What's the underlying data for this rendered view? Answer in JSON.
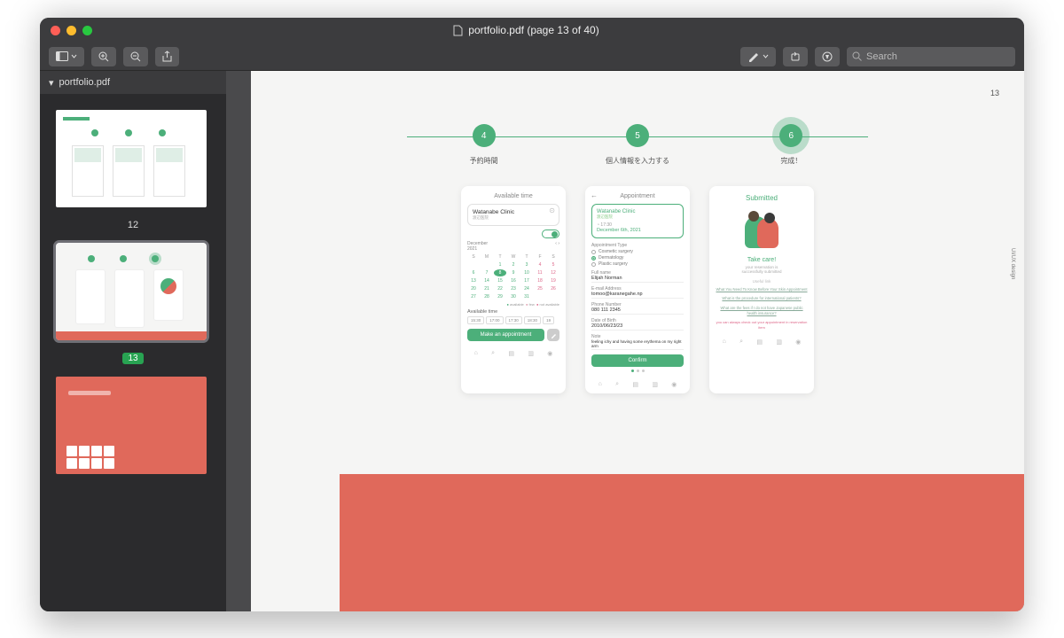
{
  "window": {
    "title": "portfolio.pdf (page 13 of 40)",
    "tab_label": "portfolio.pdf",
    "search_placeholder": "Search",
    "page_number_display": "13"
  },
  "thumbs": {
    "p12_label": "12",
    "p13_label": "13"
  },
  "stepper": {
    "s4": {
      "num": "4",
      "label": "予約時間"
    },
    "s5": {
      "num": "5",
      "label": "個人情報を入力する"
    },
    "s6": {
      "num": "6",
      "label": "完成！"
    }
  },
  "side_text": "UI/UX design",
  "card1": {
    "title": "Available time",
    "clinic_name": "Watanabe Clinic",
    "clinic_sub": "渡辺医院",
    "month": "December",
    "year": "2021",
    "dow": [
      "S",
      "M",
      "T",
      "W",
      "T",
      "F",
      "S"
    ],
    "weeks": [
      [
        "",
        "",
        "1",
        "2",
        "3",
        "4",
        "5"
      ],
      [
        "6",
        "7",
        "8",
        "9",
        "10",
        "11",
        "12"
      ],
      [
        "13",
        "14",
        "15",
        "16",
        "17",
        "18",
        "19"
      ],
      [
        "20",
        "21",
        "22",
        "23",
        "24",
        "25",
        "26"
      ],
      [
        "27",
        "28",
        "29",
        "30",
        "31",
        "",
        ""
      ]
    ],
    "selected_day": "8",
    "legend_available": "available",
    "legend_few": "few",
    "legend_na": "not available",
    "avail_label": "Available time",
    "slots": [
      "15:30",
      "17:00",
      "17:30",
      "18:30",
      "19"
    ],
    "button": "Make an appointment"
  },
  "card2": {
    "title": "Appointment",
    "clinic_name": "Watanabe Clinic",
    "clinic_sub": "渡辺医院",
    "time_value": "17:30",
    "date_value": "December 6th, 2021",
    "type_label": "Appointment Type",
    "types": [
      "Cosmetic surgery",
      "Dermatology",
      "Plastic surgery"
    ],
    "type_selected": 1,
    "name_label": "Full name",
    "name_value": "Elijah Norman",
    "email_label": "E-mail Address",
    "email_value": "tomoo@karanegahe.np",
    "phone_label": "Phone Number",
    "phone_value": "080 111 2345",
    "dob_label": "Date of Birth",
    "dob_value": "2010/06/23/23",
    "note_label": "Note",
    "note_value": "feeling ichy and having some erythema on my right arm",
    "confirm": "Confirm"
  },
  "card3": {
    "title": "Submitted",
    "take_care": "Take care!",
    "sub": "your reservation is\nsuccessfully submitted",
    "useful": "Useful link",
    "link1": "What You Need To Know Before Your Skin Appointment",
    "link2": "What is the procedure for international patients?",
    "link3": "What are the fees if I do not have Japanese public health insurance?",
    "note": "you can always check out your appointment in reservation item"
  }
}
